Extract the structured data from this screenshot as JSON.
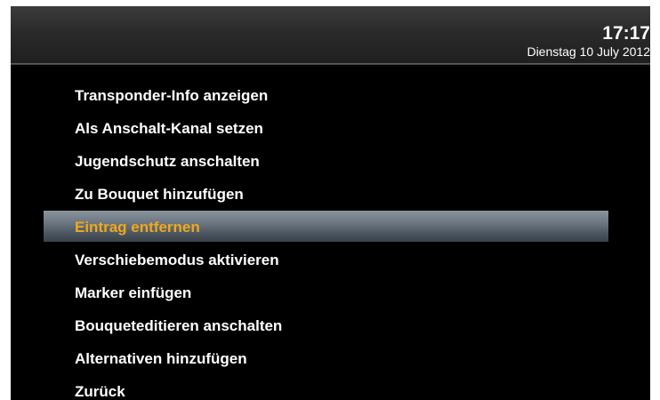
{
  "header": {
    "time": "17:17",
    "date": "Dienstag 10 July 2012"
  },
  "menu": {
    "selected_index": 4,
    "items": [
      {
        "label": "Transponder-Info anzeigen"
      },
      {
        "label": "Als Anschalt-Kanal setzen"
      },
      {
        "label": "Jugendschutz anschalten"
      },
      {
        "label": "Zu Bouquet hinzufügen"
      },
      {
        "label": "Eintrag entfernen"
      },
      {
        "label": "Verschiebemodus aktivieren"
      },
      {
        "label": "Marker einfügen"
      },
      {
        "label": "Bouqueteditieren anschalten"
      },
      {
        "label": "Alternativen hinzufügen"
      },
      {
        "label": "Zurück"
      }
    ]
  },
  "colors": {
    "background": "#000000",
    "text": "#ffffff",
    "selected_text": "#f0a81c",
    "selection_bar": "#6c7680"
  }
}
